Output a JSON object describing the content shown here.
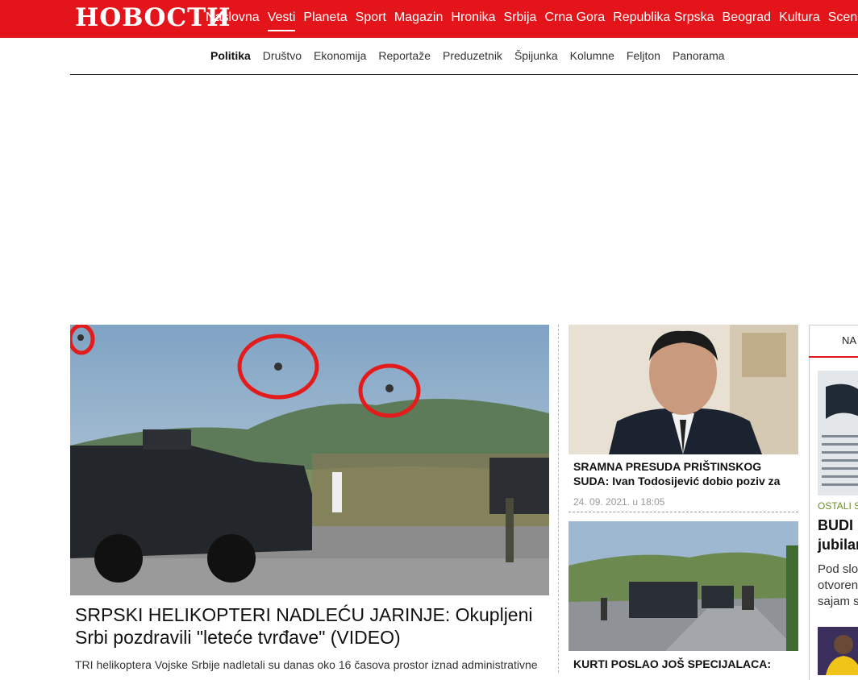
{
  "header": {
    "logo_text": "НОВОСТИ",
    "brand_color": "#e3141a",
    "nav": [
      {
        "label": "Naslovna",
        "active": false
      },
      {
        "label": "Vesti",
        "active": true
      },
      {
        "label": "Planeta",
        "active": false
      },
      {
        "label": "Sport",
        "active": false
      },
      {
        "label": "Magazin",
        "active": false
      },
      {
        "label": "Hronika",
        "active": false
      },
      {
        "label": "Srbija",
        "active": false
      },
      {
        "label": "Crna Gora",
        "active": false
      },
      {
        "label": "Republika Srpska",
        "active": false
      },
      {
        "label": "Beograd",
        "active": false
      },
      {
        "label": "Kultura",
        "active": false
      },
      {
        "label": "Scena",
        "active": false
      }
    ]
  },
  "subnav": {
    "items": [
      {
        "label": "Politika",
        "active": true
      },
      {
        "label": "Društvo",
        "active": false
      },
      {
        "label": "Ekonomija",
        "active": false
      },
      {
        "label": "Reportaže",
        "active": false
      },
      {
        "label": "Preduzetnik",
        "active": false
      },
      {
        "label": "Špijunka",
        "active": false
      },
      {
        "label": "Kolumne",
        "active": false
      },
      {
        "label": "Feljton",
        "active": false
      },
      {
        "label": "Panorama",
        "active": false
      }
    ]
  },
  "main_article": {
    "image": "helicopters-over-armored-vehicles-photo",
    "title_line1": "SRPSKI HELIKOPTERI NADLEĆU JARINJE: Okupljeni",
    "title_line2": "Srbi pozdravili \"leteće tvrđave\" (VIDEO)",
    "lead": "TRI helikoptera Vojske Srbije nadletali su danas oko 16 časova prostor iznad administrativne"
  },
  "cards": [
    {
      "image": "man-in-suit-photo",
      "title_line1": "SRAMNA PRESUDA PRIŠTINSKOG",
      "title_line2": "SUDA: Ivan Todosijević dobio poziv za",
      "date": "24. 09. 2021. u 18:05"
    },
    {
      "image": "armored-vehicles-on-road-photo",
      "title_line1": "KURTI POSLAO JOŠ SPECIJALACA:",
      "title_line2": "",
      "date": ""
    }
  ],
  "right_column": {
    "tab_label": "NA",
    "item1": {
      "image": "abstract-photo",
      "category": "OSTALI S",
      "title_line1": "BUDI I",
      "title_line2": "jubilar",
      "lead_line1": "Pod slo",
      "lead_line2": "otvoren",
      "lead_line3": "sajam s"
    },
    "item2": {
      "image": "sports-photo"
    }
  }
}
